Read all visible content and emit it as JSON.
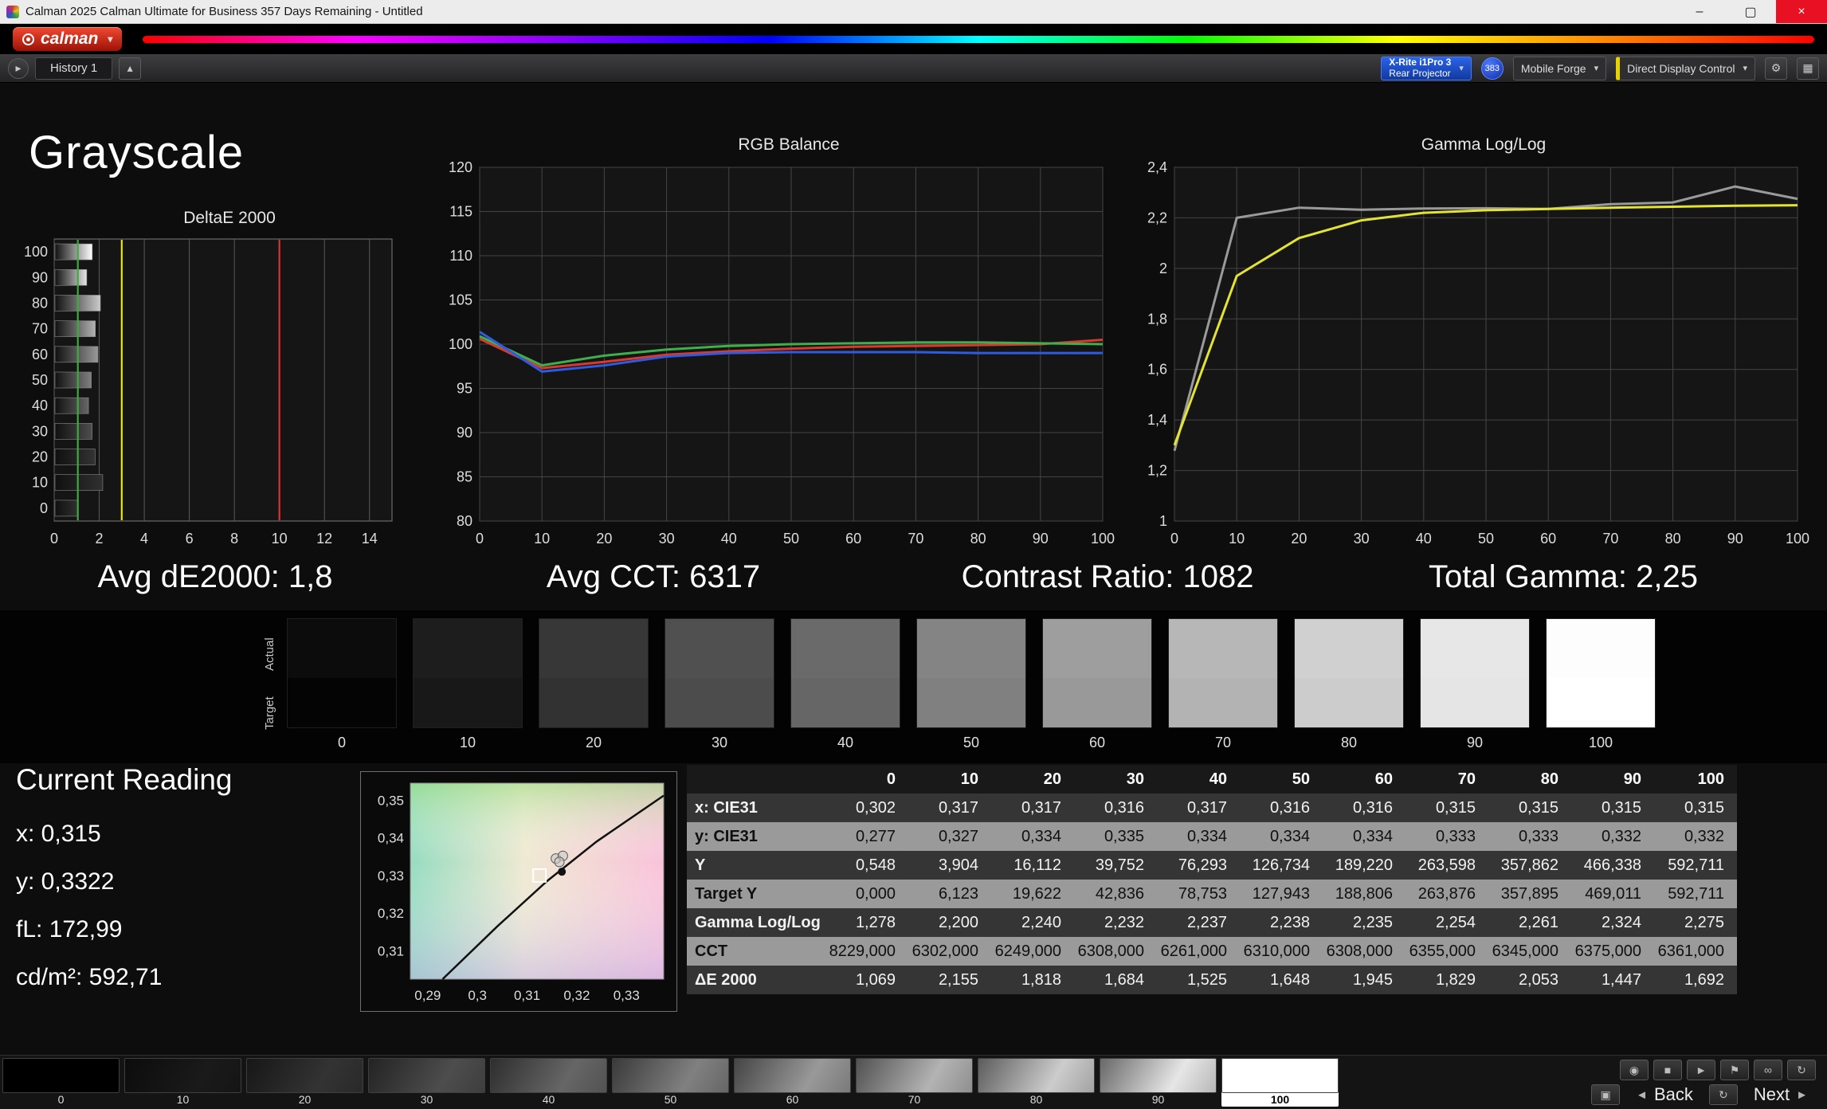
{
  "titlebar": {
    "title": "Calman 2025 Calman Ultimate for Business 357 Days Remaining  - Untitled"
  },
  "logo": {
    "brand": "calman"
  },
  "icons": {
    "caret": "▾",
    "gear": "⚙",
    "grid": "▦",
    "collapse": "▸",
    "add": "▴",
    "minimize": "–",
    "maximize": "▢",
    "close": "×",
    "back": "◄",
    "next": "►",
    "resume": "↻",
    "stop_patch": "▣"
  },
  "toolbar": {
    "history_tab": "History 1",
    "meter_line1": "X-Rite i1Pro 3",
    "meter_line2": "Rear Projector",
    "badge": "383",
    "source": "Mobile Forge",
    "display_control": "Direct Display Control"
  },
  "page": {
    "title": "Grayscale"
  },
  "stats": [
    "Avg dE2000: 1,8",
    "Avg CCT: 6317",
    "Contrast Ratio: 1082",
    "Total Gamma: 2,25"
  ],
  "chart_data": [
    {
      "type": "bar",
      "name": "deltae",
      "title": "DeltaE 2000",
      "orientation": "horizontal",
      "categories": [
        "100",
        "90",
        "80",
        "70",
        "60",
        "50",
        "40",
        "30",
        "20",
        "10",
        "0"
      ],
      "values": [
        1.692,
        1.447,
        2.053,
        1.829,
        1.945,
        1.648,
        1.525,
        1.684,
        1.818,
        2.155,
        1.069
      ],
      "xlim": [
        0,
        15
      ],
      "x_ticks": [
        0,
        2,
        4,
        6,
        8,
        10,
        12,
        14
      ],
      "reference_lines": [
        {
          "x": 1.05,
          "color": "#3faa3f"
        },
        {
          "x": 3,
          "color": "#e8e800"
        },
        {
          "x": 10,
          "color": "#e03030"
        }
      ]
    },
    {
      "type": "line",
      "name": "rgb-balance",
      "title": "RGB Balance",
      "x": [
        0,
        10,
        20,
        30,
        40,
        50,
        60,
        70,
        80,
        90,
        100
      ],
      "xlim": [
        0,
        100
      ],
      "x_ticks": [
        0,
        10,
        20,
        30,
        40,
        50,
        60,
        70,
        80,
        90,
        100
      ],
      "ylim": [
        80,
        120
      ],
      "y_ticks": [
        80,
        85,
        90,
        95,
        100,
        105,
        110,
        115,
        120
      ],
      "series": [
        {
          "name": "red",
          "color": "#d93a2e",
          "values": [
            100.6,
            97.3,
            98.0,
            98.8,
            99.2,
            99.5,
            99.7,
            99.8,
            99.9,
            100.0,
            100.5
          ]
        },
        {
          "name": "green",
          "color": "#3faf4d",
          "values": [
            100.9,
            97.6,
            98.7,
            99.4,
            99.8,
            100.0,
            100.1,
            100.2,
            100.2,
            100.1,
            100.0
          ]
        },
        {
          "name": "blue",
          "color": "#2f5be0",
          "values": [
            101.4,
            96.9,
            97.6,
            98.6,
            99.0,
            99.1,
            99.1,
            99.1,
            99.0,
            99.0,
            99.0
          ]
        }
      ]
    },
    {
      "type": "line",
      "name": "gamma",
      "title": "Gamma Log/Log",
      "x": [
        0,
        10,
        20,
        30,
        40,
        50,
        60,
        70,
        80,
        90,
        100
      ],
      "xlim": [
        0,
        100
      ],
      "x_ticks": [
        0,
        10,
        20,
        30,
        40,
        50,
        60,
        70,
        80,
        90,
        100
      ],
      "ylim": [
        1,
        2.4
      ],
      "y_ticks": [
        1,
        1.2,
        1.4,
        1.6,
        1.8,
        2,
        2.2,
        2.4
      ],
      "y_tick_labels": [
        "1",
        "1,2",
        "1,4",
        "1,6",
        "1,8",
        "2",
        "2,2",
        "2,4"
      ],
      "series": [
        {
          "name": "gamma-points",
          "color": "#9a9a9a",
          "values": [
            1.278,
            2.2,
            2.24,
            2.232,
            2.237,
            2.238,
            2.235,
            2.254,
            2.261,
            2.324,
            2.275
          ]
        },
        {
          "name": "gamma-average",
          "color": "#e3e335",
          "values": [
            1.3,
            1.97,
            2.12,
            2.19,
            2.22,
            2.23,
            2.235,
            2.24,
            2.244,
            2.248,
            2.25
          ]
        }
      ]
    }
  ],
  "swatches": {
    "actual_label": "Actual",
    "target_label": "Target",
    "levels": [
      {
        "label": "0",
        "actual": "#0c0c0c",
        "target": "#040404"
      },
      {
        "label": "10",
        "actual": "#1d1d1d",
        "target": "#181818"
      },
      {
        "label": "20",
        "actual": "#373737",
        "target": "#323232"
      },
      {
        "label": "30",
        "actual": "#505050",
        "target": "#4c4c4c"
      },
      {
        "label": "40",
        "actual": "#6a6a6a",
        "target": "#666666"
      },
      {
        "label": "50",
        "actual": "#848484",
        "target": "#808080"
      },
      {
        "label": "60",
        "actual": "#9e9e9e",
        "target": "#999999"
      },
      {
        "label": "70",
        "actual": "#b7b7b7",
        "target": "#b3b3b3"
      },
      {
        "label": "80",
        "actual": "#d0d0d0",
        "target": "#cccccc"
      },
      {
        "label": "90",
        "actual": "#e7e7e7",
        "target": "#e5e5e5"
      },
      {
        "label": "100",
        "actual": "#fdfdfd",
        "target": "#ffffff"
      }
    ]
  },
  "current_reading": {
    "title": "Current Reading",
    "lines": [
      "x: 0,315",
      "y: 0,3322",
      "fL: 172,99",
      "cd/m²: 592,71"
    ]
  },
  "cie": {
    "x_ticks": [
      "0,29",
      "0,3",
      "0,31",
      "0,32",
      "0,33"
    ],
    "x_tick_vals": [
      0.29,
      0.3,
      0.31,
      0.32,
      0.33
    ],
    "y_ticks": [
      "0,35",
      "0,34",
      "0,33",
      "0,32",
      "0,31"
    ],
    "y_tick_vals": [
      0.35,
      0.34,
      0.33,
      0.32,
      0.31
    ],
    "xlim": [
      0.2865,
      0.3375
    ],
    "ylim": [
      0.3025,
      0.3545
    ],
    "locus": [
      [
        0.293,
        0.3025
      ],
      [
        0.304,
        0.3165
      ],
      [
        0.314,
        0.3285
      ],
      [
        0.324,
        0.339
      ],
      [
        0.3375,
        0.3512
      ]
    ],
    "target": [
      0.3125,
      0.33
    ],
    "point": [
      0.317,
      0.331
    ],
    "cluster": [
      [
        0.3158,
        0.3345
      ],
      [
        0.3172,
        0.3352
      ],
      [
        0.3165,
        0.3336
      ]
    ]
  },
  "table": {
    "columns": [
      "0",
      "10",
      "20",
      "30",
      "40",
      "50",
      "60",
      "70",
      "80",
      "90",
      "100"
    ],
    "rows": [
      {
        "label": "x: CIE31",
        "values": [
          "0,302",
          "0,317",
          "0,317",
          "0,316",
          "0,317",
          "0,316",
          "0,316",
          "0,315",
          "0,315",
          "0,315",
          "0,315"
        ]
      },
      {
        "label": "y: CIE31",
        "values": [
          "0,277",
          "0,327",
          "0,334",
          "0,335",
          "0,334",
          "0,334",
          "0,334",
          "0,333",
          "0,333",
          "0,332",
          "0,332"
        ]
      },
      {
        "label": "Y",
        "values": [
          "0,548",
          "3,904",
          "16,112",
          "39,752",
          "76,293",
          "126,734",
          "189,220",
          "263,598",
          "357,862",
          "466,338",
          "592,711"
        ]
      },
      {
        "label": "Target Y",
        "values": [
          "0,000",
          "6,123",
          "19,622",
          "42,836",
          "78,753",
          "127,943",
          "188,806",
          "263,876",
          "357,895",
          "469,011",
          "592,711"
        ]
      },
      {
        "label": "Gamma Log/Log",
        "values": [
          "1,278",
          "2,200",
          "2,240",
          "2,232",
          "2,237",
          "2,238",
          "2,235",
          "2,254",
          "2,261",
          "2,324",
          "2,275"
        ]
      },
      {
        "label": "CCT",
        "values": [
          "8229,000",
          "6302,000",
          "6249,000",
          "6308,000",
          "6261,000",
          "6310,000",
          "6308,000",
          "6355,000",
          "6345,000",
          "6375,000",
          "6361,000"
        ]
      },
      {
        "label": "ΔE 2000",
        "values": [
          "1,069",
          "2,155",
          "1,818",
          "1,684",
          "1,525",
          "1,648",
          "1,945",
          "1,829",
          "2,053",
          "1,447",
          "1,692"
        ]
      }
    ]
  },
  "bottom": {
    "patches": [
      "0",
      "10",
      "20",
      "30",
      "40",
      "50",
      "60",
      "70",
      "80",
      "90",
      "100"
    ],
    "selected_index": 10,
    "controls": [
      {
        "name": "record",
        "glyph": "◉"
      },
      {
        "name": "stop",
        "glyph": "■"
      },
      {
        "name": "play",
        "glyph": "►"
      },
      {
        "name": "flag",
        "glyph": "⚑"
      },
      {
        "name": "loop",
        "glyph": "∞"
      },
      {
        "name": "refresh",
        "glyph": "↻"
      }
    ],
    "back": "Back",
    "next": "Next"
  }
}
